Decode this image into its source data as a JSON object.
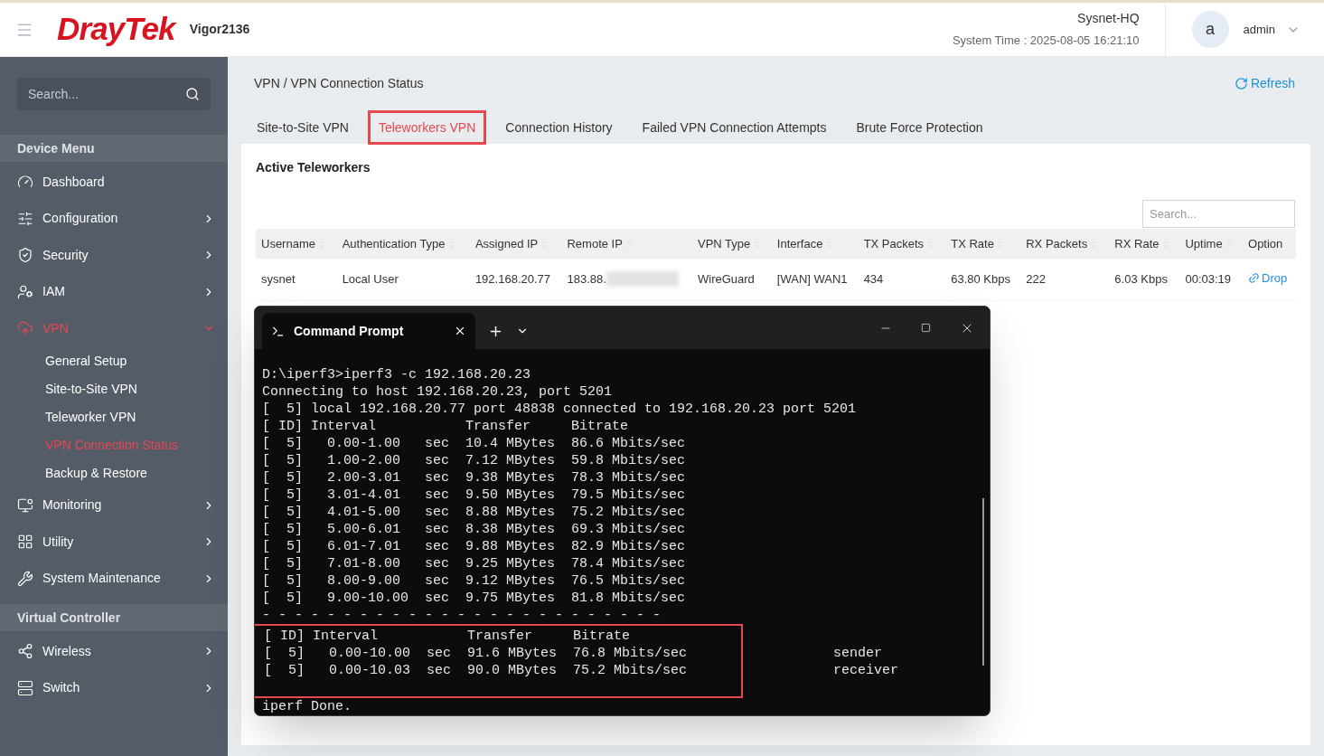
{
  "header": {
    "brand": "DrayTek",
    "model": "Vigor2136",
    "site": "Sysnet-HQ",
    "system_time": "System Time : 2025-08-05 16:21:10",
    "avatar": "a",
    "user": "admin"
  },
  "sidebar": {
    "search_placeholder": "Search...",
    "sections": [
      {
        "title": "Device Menu",
        "items": [
          {
            "label": "Dashboard"
          },
          {
            "label": "Configuration",
            "expanded": false
          },
          {
            "label": "Security",
            "expanded": false
          },
          {
            "label": "IAM",
            "expanded": false
          },
          {
            "label": "VPN",
            "expanded": true,
            "children": [
              {
                "label": "General Setup",
                "selected": false
              },
              {
                "label": "Site-to-Site VPN",
                "selected": false
              },
              {
                "label": "Teleworker VPN",
                "selected": false
              },
              {
                "label": "VPN Connection Status",
                "selected": true
              },
              {
                "label": "Backup & Restore",
                "selected": false
              }
            ]
          },
          {
            "label": "Monitoring",
            "expanded": false
          },
          {
            "label": "Utility",
            "expanded": false
          },
          {
            "label": "System Maintenance",
            "expanded": false
          }
        ]
      },
      {
        "title": "Virtual Controller",
        "items": [
          {
            "label": "Wireless",
            "expanded": false
          },
          {
            "label": "Switch",
            "expanded": false
          }
        ]
      }
    ]
  },
  "breadcrumb": "VPN / VPN Connection Status",
  "refresh": "Refresh",
  "tabs": [
    {
      "label": "Site-to-Site VPN",
      "selected": false,
      "highlighted": false
    },
    {
      "label": "Teleworkers VPN",
      "selected": true,
      "highlighted": true
    },
    {
      "label": "Connection History",
      "selected": false,
      "highlighted": false
    },
    {
      "label": "Failed VPN Connection Attempts",
      "selected": false,
      "highlighted": false
    },
    {
      "label": "Brute Force Protection",
      "selected": false,
      "highlighted": false
    }
  ],
  "card": {
    "title": "Active Teleworkers",
    "search_placeholder": "Search...",
    "table": {
      "columns": [
        {
          "label": "Username",
          "sortable": true
        },
        {
          "label": "Authentication Type",
          "sortable": true
        },
        {
          "label": "Assigned IP",
          "sortable": true
        },
        {
          "label": "Remote IP",
          "sortable": true
        },
        {
          "label": "VPN Type",
          "sortable": true
        },
        {
          "label": "Interface",
          "sortable": true
        },
        {
          "label": "TX Packets",
          "sortable": true
        },
        {
          "label": "TX Rate",
          "sortable": true
        },
        {
          "label": "RX Packets",
          "sortable": true
        },
        {
          "label": "RX Rate",
          "sortable": true
        },
        {
          "label": "Uptime",
          "sortable": true
        },
        {
          "label": "Option",
          "sortable": false
        }
      ],
      "rows": [
        {
          "cells": [
            {
              "text": "sysnet"
            },
            {
              "text": "Local User"
            },
            {
              "text": "192.168.20.77"
            },
            {
              "text": "183.88.",
              "redacted": true
            },
            {
              "text": "WireGuard"
            },
            {
              "text": "[WAN] WAN1"
            },
            {
              "text": "434"
            },
            {
              "text": "63.80 Kbps"
            },
            {
              "text": "222"
            },
            {
              "text": "6.03 Kbps"
            },
            {
              "text": "00:03:19"
            },
            {
              "text": "Drop",
              "kind": "link"
            }
          ]
        }
      ]
    }
  },
  "terminal": {
    "tab_title": "Command Prompt",
    "lines": [
      "D:\\iperf3>iperf3 -c 192.168.20.23",
      "Connecting to host 192.168.20.23, port 5201",
      "[  5] local 192.168.20.77 port 48838 connected to 192.168.20.23 port 5201",
      "[ ID] Interval           Transfer     Bitrate",
      "[  5]   0.00-1.00   sec  10.4 MBytes  86.6 Mbits/sec",
      "[  5]   1.00-2.00   sec  7.12 MBytes  59.8 Mbits/sec",
      "[  5]   2.00-3.01   sec  9.38 MBytes  78.3 Mbits/sec",
      "[  5]   3.01-4.01   sec  9.50 MBytes  79.5 Mbits/sec",
      "[  5]   4.01-5.00   sec  8.88 MBytes  75.2 Mbits/sec",
      "[  5]   5.00-6.01   sec  8.38 MBytes  69.3 Mbits/sec",
      "[  5]   6.01-7.01   sec  9.88 MBytes  82.9 Mbits/sec",
      "[  5]   7.01-8.00   sec  9.25 MBytes  78.4 Mbits/sec",
      "[  5]   8.00-9.00   sec  9.12 MBytes  76.5 Mbits/sec",
      "[  5]   9.00-10.00  sec  9.75 MBytes  81.8 Mbits/sec",
      "- - - - - - - - - - - - - - - - - - - - - - - - -"
    ],
    "summary": {
      "highlighted": true,
      "lines": [
        "[ ID] Interval           Transfer     Bitrate",
        "[  5]   0.00-10.00  sec  91.6 MBytes  76.8 Mbits/sec                  sender",
        "[  5]   0.00-10.03  sec  90.0 MBytes  75.2 Mbits/sec                  receiver"
      ]
    },
    "footer_lines": [
      "iperf Done."
    ]
  }
}
